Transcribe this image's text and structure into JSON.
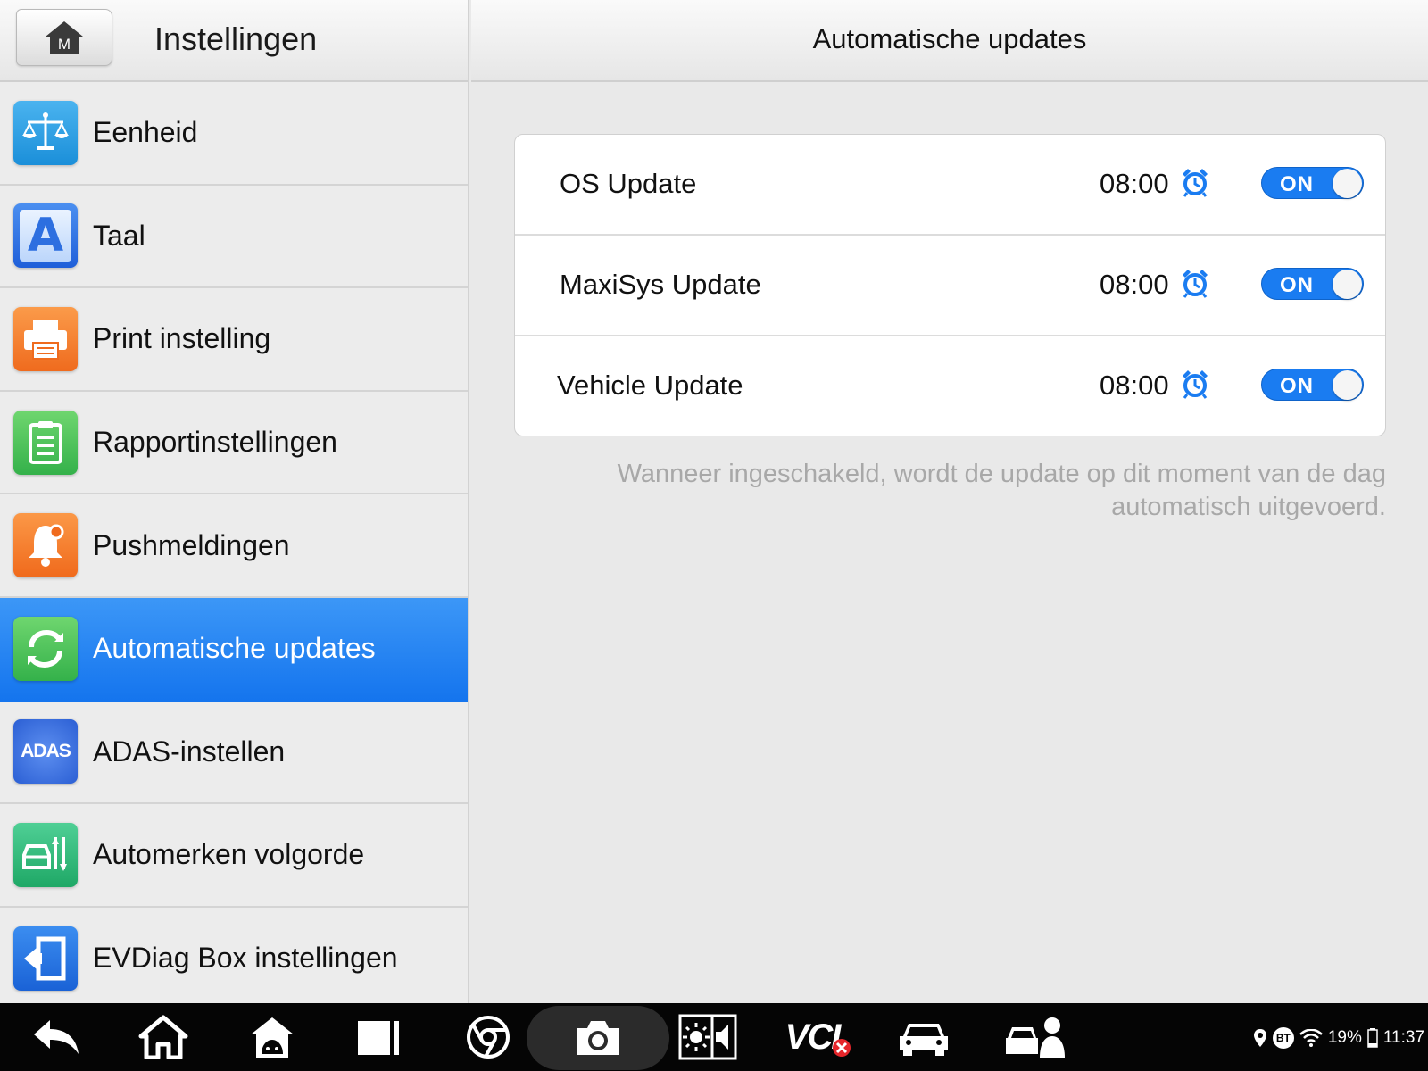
{
  "left_header": {
    "title": "Instellingen",
    "home_letter": "M"
  },
  "menu": [
    {
      "label": "Eenheid"
    },
    {
      "label": "Taal",
      "icon_letter": "A"
    },
    {
      "label": "Print instelling"
    },
    {
      "label": "Rapportinstellingen"
    },
    {
      "label": "Pushmeldingen"
    },
    {
      "label": "Automatische updates",
      "active": true
    },
    {
      "label": "ADAS-instellen",
      "icon_text": "ADAS"
    },
    {
      "label": "Automerken volgorde"
    },
    {
      "label": "EVDiag Box instellingen"
    }
  ],
  "right_header": {
    "title": "Automatische updates"
  },
  "updates": [
    {
      "label": "OS Update",
      "time": "08:00",
      "toggle": "ON"
    },
    {
      "label": "MaxiSys Update",
      "time": "08:00",
      "toggle": "ON"
    },
    {
      "label": "Vehicle Update",
      "time": "08:00",
      "toggle": "ON"
    }
  ],
  "help_text_line1": "Wanneer ingeschakeld, wordt de update op dit moment van de dag",
  "help_text_line2": "automatisch uitgevoerd.",
  "taskbar": {
    "vci_label": "VCI",
    "status": {
      "bt": "BT",
      "battery": "19%",
      "time": "11:37"
    }
  },
  "colors": {
    "accent": "#1a7cf1",
    "active_menu": "#1e80f2",
    "help_text": "#a8a8a8"
  }
}
